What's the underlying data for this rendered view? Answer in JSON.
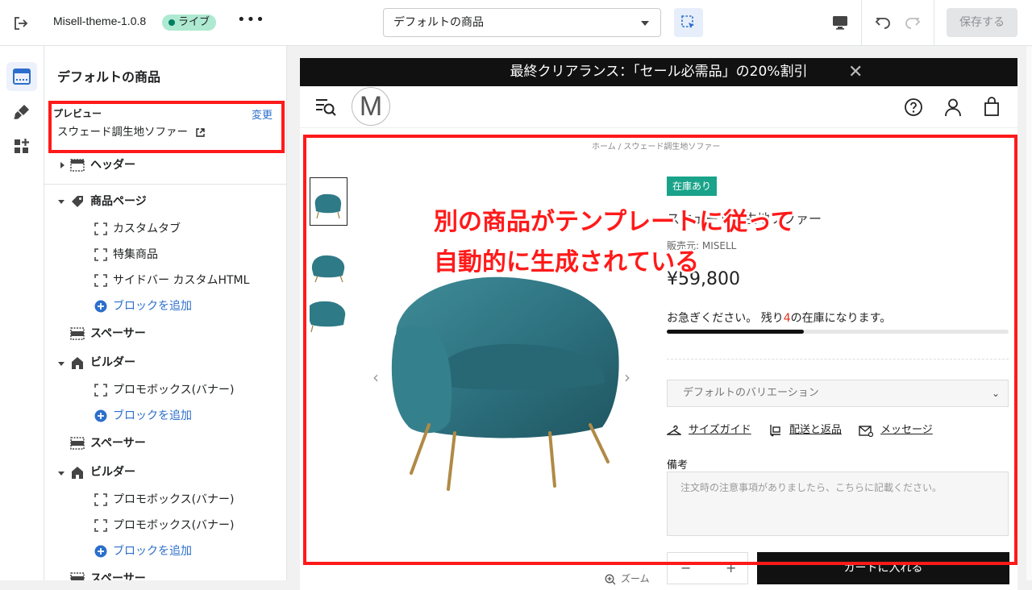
{
  "topbar": {
    "theme_name": "Misell-theme-1.0.8",
    "live_badge": "ライブ",
    "more": "•••",
    "template_select": "デフォルトの商品",
    "save_label": "保存する"
  },
  "sidebar": {
    "title": "デフォルトの商品",
    "preview": {
      "label": "プレビュー",
      "change": "変更",
      "product": "スウェード調生地ソファー"
    },
    "items": [
      {
        "label": "ヘッダー"
      },
      {
        "label": "商品ページ"
      },
      {
        "label": "カスタムタブ"
      },
      {
        "label": "特集商品"
      },
      {
        "label": "サイドバー カスタムHTML"
      },
      {
        "label": "ブロックを追加"
      },
      {
        "label": "スペーサー"
      },
      {
        "label": "ビルダー"
      },
      {
        "label": "プロモボックス(バナー)"
      },
      {
        "label": "ブロックを追加"
      },
      {
        "label": "スペーサー"
      },
      {
        "label": "ビルダー"
      },
      {
        "label": "プロモボックス(バナー)"
      },
      {
        "label": "プロモボックス(バナー)"
      },
      {
        "label": "ブロックを追加"
      },
      {
        "label": "スペーサー"
      }
    ]
  },
  "store": {
    "announcement": "最終クリアランス：「セール必需品」の20%割引",
    "announcement_close": "✕",
    "logo": "M",
    "breadcrumb": "ホーム  /  スウェード調生地ソファー",
    "stock_badge": "在庫あり",
    "product_title": "スウェード調生地ソファー",
    "vendor": "販売元: MISELL",
    "price": "¥59,800",
    "stock_prefix": "お急ぎください。 残り",
    "stock_num": "4",
    "stock_suffix": "の在庫になります。",
    "stock_level": 0.4,
    "variant": "デフォルトのバリエーション",
    "links": [
      "サイズガイド",
      "配送と返品",
      "メッセージ"
    ],
    "note_label": "備考",
    "note_placeholder": "注文時の注意事項がありましたら、こちらに記載ください。",
    "qty_minus": "−",
    "qty_plus": "+",
    "add_to_cart": "カートに入れる",
    "zoom": "ズーム"
  },
  "annotation": {
    "line1": "別の商品がテンプレートに従って",
    "line2": "自動的に生成されている"
  },
  "colors": {
    "accent": "#2c6ecb",
    "annotation_red": "#ff1a1a",
    "live_green": "#aee9d1",
    "stock_badge": "#19a38a"
  }
}
